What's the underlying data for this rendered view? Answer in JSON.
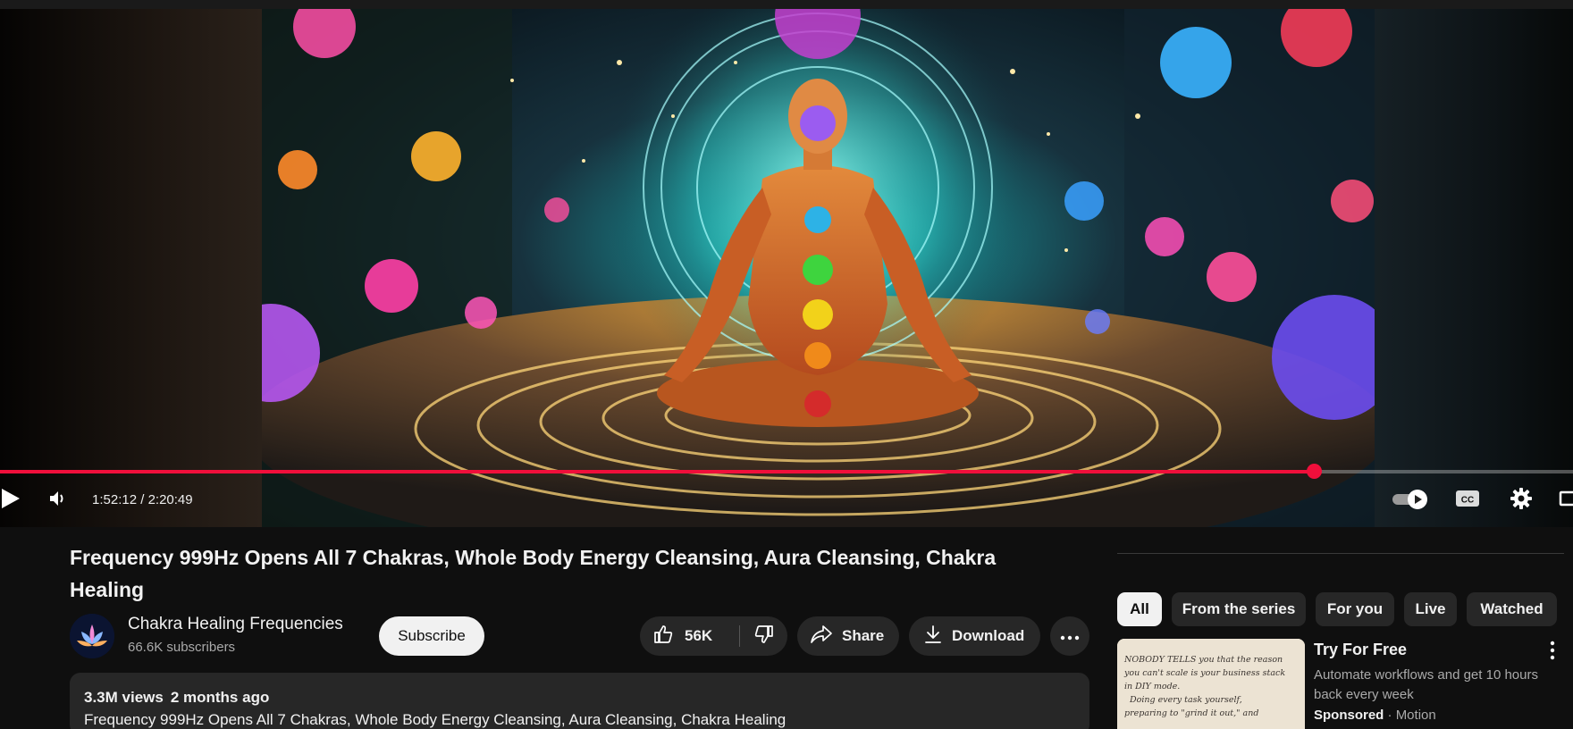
{
  "player": {
    "current_time": "1:52:12",
    "duration": "2:20:49",
    "time_separator": " / ",
    "progress_fraction": 0.835,
    "accent_color": "#f00f3b",
    "autoplay_on": true
  },
  "video": {
    "title": "Frequency 999Hz Opens All 7 Chakras, Whole Body Energy Cleansing, Aura Cleansing, Chakra Healing"
  },
  "channel": {
    "name": "Chakra Healing Frequencies",
    "subscribers": "66.6K subscribers",
    "subscribe_label": "Subscribe"
  },
  "actions": {
    "like_count": "56K",
    "share_label": "Share",
    "download_label": "Download"
  },
  "description": {
    "views": "3.3M views",
    "age": "2 months ago",
    "text": "Frequency 999Hz Opens All 7 Chakras, Whole Body Energy Cleansing, Aura Cleansing, Chakra Healing"
  },
  "chips": [
    "All",
    "From the series",
    "For you",
    "Live",
    "Watched"
  ],
  "ad": {
    "title": "Try For Free",
    "description": "Automate workflows and get 10 hours back every week",
    "sponsored_label": "Sponsored",
    "separator": " · ",
    "advertiser": "Motion",
    "thumbnail_lines": [
      "NOBODY TELLS you that the reason",
      "you can't scale is your business stack",
      "in DIY mode.",
      "Doing every task yourself,",
      "preparing to \"grind it out,\" and"
    ]
  },
  "icons": [
    "play-icon",
    "volume-icon",
    "autoplay-toggle-icon",
    "captions-icon",
    "settings-gear-icon",
    "miniplayer-icon",
    "thumbs-up-icon",
    "thumbs-down-icon",
    "share-arrow-icon",
    "download-icon",
    "more-horiz-icon",
    "more-vert-icon"
  ]
}
